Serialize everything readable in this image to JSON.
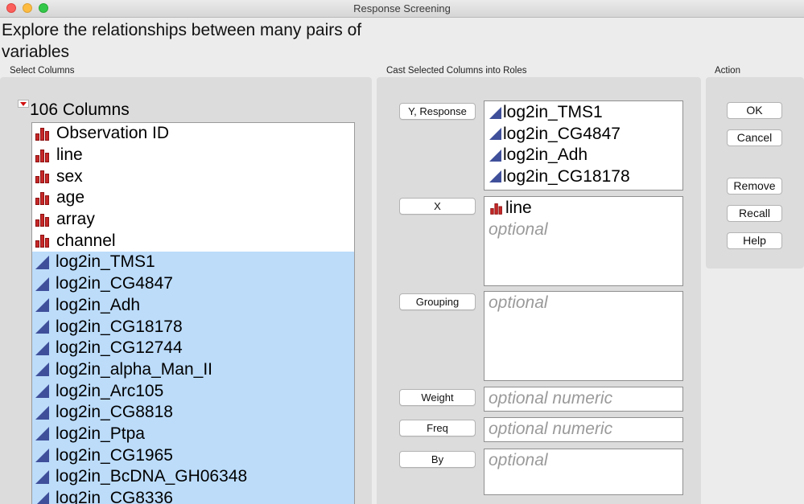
{
  "window": {
    "title": "Response Screening"
  },
  "headline": "Explore the relationships between many pairs of variables",
  "sections": {
    "select_columns": "Select Columns",
    "cast_roles": "Cast Selected Columns into Roles",
    "action": "Action"
  },
  "column_count": "106 Columns",
  "columns": [
    {
      "name": "Observation ID",
      "type": "nominal",
      "selected": false
    },
    {
      "name": "line",
      "type": "nominal",
      "selected": false
    },
    {
      "name": "sex",
      "type": "nominal",
      "selected": false
    },
    {
      "name": "age",
      "type": "nominal",
      "selected": false
    },
    {
      "name": "array",
      "type": "nominal",
      "selected": false
    },
    {
      "name": "channel",
      "type": "nominal",
      "selected": false
    },
    {
      "name": "log2in_TMS1",
      "type": "continuous",
      "selected": true
    },
    {
      "name": "log2in_CG4847",
      "type": "continuous",
      "selected": true
    },
    {
      "name": "log2in_Adh",
      "type": "continuous",
      "selected": true
    },
    {
      "name": "log2in_CG18178",
      "type": "continuous",
      "selected": true
    },
    {
      "name": "log2in_CG12744",
      "type": "continuous",
      "selected": true
    },
    {
      "name": "log2in_alpha_Man_II",
      "type": "continuous",
      "selected": true
    },
    {
      "name": "log2in_Arc105",
      "type": "continuous",
      "selected": true
    },
    {
      "name": "log2in_CG8818",
      "type": "continuous",
      "selected": true
    },
    {
      "name": "log2in_Ptpa",
      "type": "continuous",
      "selected": true
    },
    {
      "name": "log2in_CG1965",
      "type": "continuous",
      "selected": true
    },
    {
      "name": "log2in_BcDNA_GH06348",
      "type": "continuous",
      "selected": true
    },
    {
      "name": "log2in_CG8336",
      "type": "continuous",
      "selected": true
    }
  ],
  "roles": {
    "y_response": {
      "label": "Y, Response",
      "items": [
        "log2in_TMS1",
        "log2in_CG4847",
        "log2in_Adh",
        "log2in_CG18178"
      ]
    },
    "x": {
      "label": "X",
      "item": "line",
      "placeholder": "optional"
    },
    "grouping": {
      "label": "Grouping",
      "placeholder": "optional"
    },
    "weight": {
      "label": "Weight",
      "placeholder": "optional numeric"
    },
    "freq": {
      "label": "Freq",
      "placeholder": "optional numeric"
    },
    "by": {
      "label": "By",
      "placeholder": "optional"
    }
  },
  "actions": {
    "ok": "OK",
    "cancel": "Cancel",
    "remove": "Remove",
    "recall": "Recall",
    "help": "Help"
  },
  "colors": {
    "selection": "#bcdcfa",
    "nominal_icon": "#c62828",
    "continuous_icon": "#3f4f9a",
    "placeholder": "#9a9a9a"
  }
}
